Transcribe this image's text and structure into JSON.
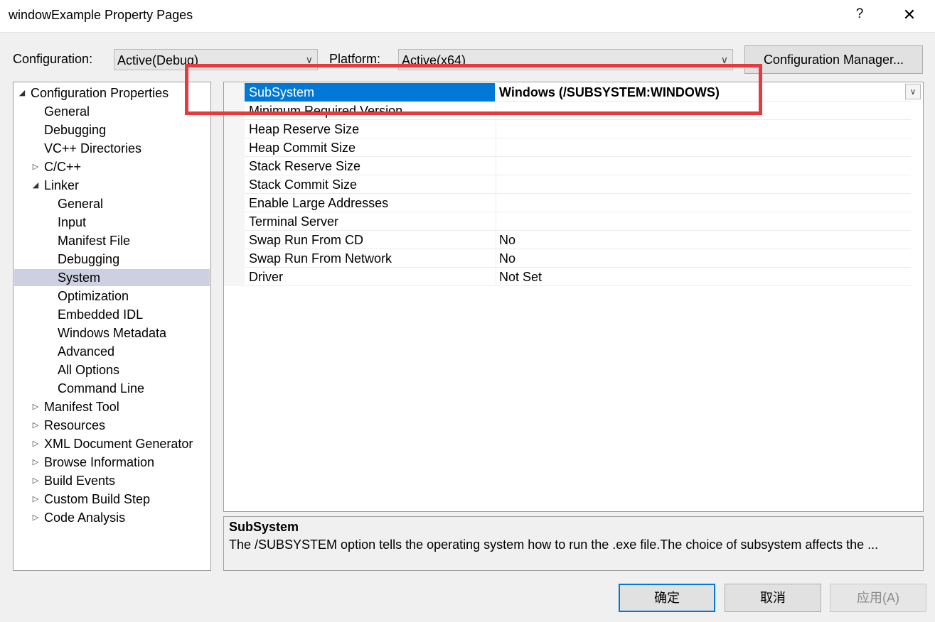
{
  "window": {
    "title": "windowExample Property Pages",
    "help": "?",
    "close": "✕"
  },
  "config_bar": {
    "configuration_label": "Configuration:",
    "configuration_value": "Active(Debug)",
    "platform_label": "Platform:",
    "platform_value": "Active(x64)",
    "config_manager_label": "Configuration Manager..."
  },
  "tree": {
    "items": [
      {
        "label": "Configuration Properties",
        "level": 0,
        "expander": "expanded"
      },
      {
        "label": "General",
        "level": 1,
        "expander": "none"
      },
      {
        "label": "Debugging",
        "level": 1,
        "expander": "none"
      },
      {
        "label": "VC++ Directories",
        "level": 1,
        "expander": "none"
      },
      {
        "label": "C/C++",
        "level": 1,
        "expander": "collapsed"
      },
      {
        "label": "Linker",
        "level": 1,
        "expander": "expanded"
      },
      {
        "label": "General",
        "level": 2,
        "expander": "none"
      },
      {
        "label": "Input",
        "level": 2,
        "expander": "none"
      },
      {
        "label": "Manifest File",
        "level": 2,
        "expander": "none"
      },
      {
        "label": "Debugging",
        "level": 2,
        "expander": "none"
      },
      {
        "label": "System",
        "level": 2,
        "expander": "none",
        "selected": true
      },
      {
        "label": "Optimization",
        "level": 2,
        "expander": "none"
      },
      {
        "label": "Embedded IDL",
        "level": 2,
        "expander": "none"
      },
      {
        "label": "Windows Metadata",
        "level": 2,
        "expander": "none"
      },
      {
        "label": "Advanced",
        "level": 2,
        "expander": "none"
      },
      {
        "label": "All Options",
        "level": 2,
        "expander": "none"
      },
      {
        "label": "Command Line",
        "level": 2,
        "expander": "none"
      },
      {
        "label": "Manifest Tool",
        "level": 1,
        "expander": "collapsed"
      },
      {
        "label": "Resources",
        "level": 1,
        "expander": "collapsed"
      },
      {
        "label": "XML Document Generator",
        "level": 1,
        "expander": "collapsed"
      },
      {
        "label": "Browse Information",
        "level": 1,
        "expander": "collapsed"
      },
      {
        "label": "Build Events",
        "level": 1,
        "expander": "collapsed"
      },
      {
        "label": "Custom Build Step",
        "level": 1,
        "expander": "collapsed"
      },
      {
        "label": "Code Analysis",
        "level": 1,
        "expander": "collapsed"
      }
    ]
  },
  "grid": {
    "rows": [
      {
        "name": "SubSystem",
        "value": "Windows (/SUBSYSTEM:WINDOWS)",
        "selected": true,
        "bold": true
      },
      {
        "name": "Minimum Required Version",
        "value": ""
      },
      {
        "name": "Heap Reserve Size",
        "value": ""
      },
      {
        "name": "Heap Commit Size",
        "value": ""
      },
      {
        "name": "Stack Reserve Size",
        "value": ""
      },
      {
        "name": "Stack Commit Size",
        "value": ""
      },
      {
        "name": "Enable Large Addresses",
        "value": ""
      },
      {
        "name": "Terminal Server",
        "value": ""
      },
      {
        "name": "Swap Run From CD",
        "value": "No"
      },
      {
        "name": "Swap Run From Network",
        "value": "No"
      },
      {
        "name": "Driver",
        "value": "Not Set"
      }
    ]
  },
  "description": {
    "title": "SubSystem",
    "text": "The /SUBSYSTEM option tells the operating system how to run the .exe file.The choice of subsystem affects the ..."
  },
  "buttons": {
    "ok": "确定",
    "cancel": "取消",
    "apply": "应用(A)"
  },
  "colors": {
    "selection": "#0078d7",
    "tree_selection": "#ccd0e0",
    "highlight": "#e8393f"
  }
}
